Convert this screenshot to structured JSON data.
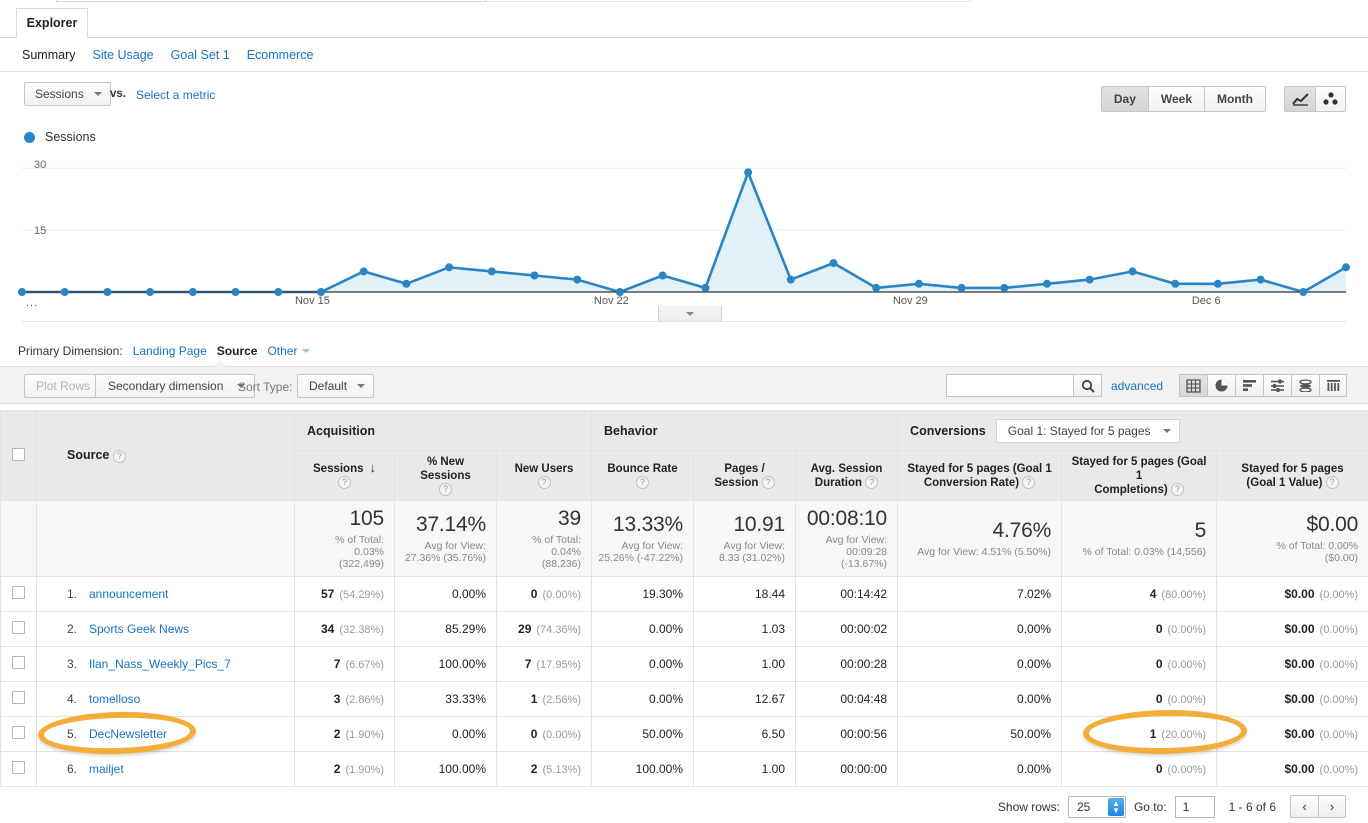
{
  "window": {
    "tab_label": "Explorer"
  },
  "subtabs": [
    {
      "label": "Summary",
      "active": true
    },
    {
      "label": "Site Usage",
      "active": false
    },
    {
      "label": "Goal Set 1",
      "active": false
    },
    {
      "label": "Ecommerce",
      "active": false
    }
  ],
  "metric_bar": {
    "metric_selected": "Sessions",
    "vs_label": "vs.",
    "select_metric_link": "Select a metric",
    "granularity": [
      {
        "label": "Day",
        "active": true
      },
      {
        "label": "Week",
        "active": false
      },
      {
        "label": "Month",
        "active": false
      }
    ],
    "chart_type_icons": [
      {
        "name": "line-chart-icon",
        "active": true
      },
      {
        "name": "motion-chart-icon",
        "active": false
      }
    ]
  },
  "legend": {
    "series_label": "Sessions",
    "color": "#2b85c4"
  },
  "chart_data": {
    "type": "line",
    "title": "Sessions",
    "xlabel": "",
    "ylabel": "Sessions",
    "ylim": [
      0,
      32
    ],
    "yticks": [
      15,
      30
    ],
    "ytick_labels": [
      "15",
      "30"
    ],
    "grid": true,
    "legend_position": "top-left",
    "x_axis_prefix": "...",
    "xtick_labels": [
      "Nov 15",
      "Nov 22",
      "Nov 29",
      "Dec 6"
    ],
    "xtick_indices": [
      7,
      14,
      21,
      28
    ],
    "series": [
      {
        "name": "Sessions",
        "color": "#2b85c4",
        "fill": "#e2f0f8",
        "values": [
          0,
          0,
          0,
          0,
          0,
          0,
          0,
          0,
          5,
          2,
          6,
          5,
          4,
          3,
          0,
          4,
          1,
          29,
          3,
          7,
          1,
          2,
          1,
          1,
          2,
          3,
          5,
          2,
          2,
          3,
          0,
          6
        ]
      }
    ]
  },
  "primary_dimension": {
    "label": "Primary Dimension:",
    "options": [
      {
        "label": "Landing Page",
        "active": false
      },
      {
        "label": "Source",
        "active": true
      },
      {
        "label": "Other",
        "active": false,
        "has_caret": true
      }
    ]
  },
  "toolbar": {
    "plot_rows_label": "Plot Rows",
    "secondary_dimension_label": "Secondary dimension",
    "sort_type_label": "Sort Type:",
    "sort_type_value": "Default",
    "search_value": "",
    "search_placeholder": "",
    "advanced_link": "advanced",
    "view_icons": [
      {
        "name": "table-view-icon",
        "active": true
      },
      {
        "name": "pie-view-icon",
        "active": false
      },
      {
        "name": "bar-view-icon",
        "active": false
      },
      {
        "name": "comparison-view-icon",
        "active": false
      },
      {
        "name": "performance-view-icon",
        "active": false
      },
      {
        "name": "pivot-view-icon",
        "active": false
      }
    ]
  },
  "table": {
    "source_header": "Source",
    "groups": [
      {
        "label": "Acquisition",
        "span": 3
      },
      {
        "label": "Behavior",
        "span": 3
      },
      {
        "label": "Conversions",
        "span": 3,
        "goal_select": "Goal 1: Stayed for 5 pages"
      }
    ],
    "columns": [
      {
        "label": "Sessions",
        "sorted": true,
        "sort_dir": "desc"
      },
      {
        "label": "% New Sessions"
      },
      {
        "label": "New Users"
      },
      {
        "label": "Bounce Rate"
      },
      {
        "label": "Pages /\nSession"
      },
      {
        "label": "Avg. Session\nDuration"
      },
      {
        "label": "Stayed for 5 pages (Goal 1\nConversion Rate)"
      },
      {
        "label": "Stayed for 5 pages (Goal 1\nCompletions)"
      },
      {
        "label": "Stayed for 5 pages\n(Goal 1 Value)"
      }
    ],
    "summary": [
      {
        "big": "105",
        "small": "% of Total:\n0.03%\n(322,499)"
      },
      {
        "big": "37.14%",
        "small": "Avg for View:\n27.36% (35.76%)"
      },
      {
        "big": "39",
        "small": "% of Total:\n0.04%\n(88,236)"
      },
      {
        "big": "13.33%",
        "small": "Avg for View:\n25.26% (-47.22%)"
      },
      {
        "big": "10.91",
        "small": "Avg for View:\n8.33 (31.02%)"
      },
      {
        "big": "00:08:10",
        "small": "Avg for View:\n00:09:28\n(-13.67%)"
      },
      {
        "big": "4.76%",
        "small": "Avg for View: 4.51% (5.50%)"
      },
      {
        "big": "5",
        "small": "% of Total: 0.03% (14,556)"
      },
      {
        "big": "$0.00",
        "small": "% of Total: 0.00%\n($0.00)"
      }
    ],
    "rows": [
      {
        "num": "1.",
        "source": "announcement",
        "sessions": "57",
        "sessions_pct": "(54.29%)",
        "new_sessions_pct": "0.00%",
        "new_users": "0",
        "new_users_pct": "(0.00%)",
        "bounce_rate": "19.30%",
        "pages_session": "18.44",
        "avg_duration": "00:14:42",
        "goal_rate": "7.02%",
        "goal_completions": "4",
        "goal_completions_pct": "(80.00%)",
        "goal_value": "$0.00",
        "goal_value_pct": "(0.00%)"
      },
      {
        "num": "2.",
        "source": "Sports Geek News",
        "sessions": "34",
        "sessions_pct": "(32.38%)",
        "new_sessions_pct": "85.29%",
        "new_users": "29",
        "new_users_pct": "(74.36%)",
        "bounce_rate": "0.00%",
        "pages_session": "1.03",
        "avg_duration": "00:00:02",
        "goal_rate": "0.00%",
        "goal_completions": "0",
        "goal_completions_pct": "(0.00%)",
        "goal_value": "$0.00",
        "goal_value_pct": "(0.00%)"
      },
      {
        "num": "3.",
        "source": "Ilan_Nass_Weekly_Pics_7",
        "sessions": "7",
        "sessions_pct": "(6.67%)",
        "new_sessions_pct": "100.00%",
        "new_users": "7",
        "new_users_pct": "(17.95%)",
        "bounce_rate": "0.00%",
        "pages_session": "1.00",
        "avg_duration": "00:00:28",
        "goal_rate": "0.00%",
        "goal_completions": "0",
        "goal_completions_pct": "(0.00%)",
        "goal_value": "$0.00",
        "goal_value_pct": "(0.00%)"
      },
      {
        "num": "4.",
        "source": "tomelloso",
        "sessions": "3",
        "sessions_pct": "(2.86%)",
        "new_sessions_pct": "33.33%",
        "new_users": "1",
        "new_users_pct": "(2.56%)",
        "bounce_rate": "0.00%",
        "pages_session": "12.67",
        "avg_duration": "00:04:48",
        "goal_rate": "0.00%",
        "goal_completions": "0",
        "goal_completions_pct": "(0.00%)",
        "goal_value": "$0.00",
        "goal_value_pct": "(0.00%)"
      },
      {
        "num": "5.",
        "source": "DecNewsletter",
        "sessions": "2",
        "sessions_pct": "(1.90%)",
        "new_sessions_pct": "0.00%",
        "new_users": "0",
        "new_users_pct": "(0.00%)",
        "bounce_rate": "50.00%",
        "pages_session": "6.50",
        "avg_duration": "00:00:56",
        "goal_rate": "50.00%",
        "goal_completions": "1",
        "goal_completions_pct": "(20.00%)",
        "goal_value": "$0.00",
        "goal_value_pct": "(0.00%)"
      },
      {
        "num": "6.",
        "source": "mailjet",
        "sessions": "2",
        "sessions_pct": "(1.90%)",
        "new_sessions_pct": "100.00%",
        "new_users": "2",
        "new_users_pct": "(5.13%)",
        "bounce_rate": "100.00%",
        "pages_session": "1.00",
        "avg_duration": "00:00:00",
        "goal_rate": "0.00%",
        "goal_completions": "0",
        "goal_completions_pct": "(0.00%)",
        "goal_value": "$0.00",
        "goal_value_pct": "(0.00%)"
      }
    ]
  },
  "highlights": {
    "color": "#f4a72a",
    "items": [
      {
        "name": "highlight-source-decnewsletter",
        "target": "row 5 Source"
      },
      {
        "name": "highlight-goal-completions",
        "target": "row 5 Goal 1 Completions"
      }
    ]
  },
  "footer": {
    "show_rows_label": "Show rows:",
    "show_rows_value": "25",
    "goto_label": "Go to:",
    "goto_value": "1",
    "range_label": "1 - 6 of 6",
    "prev_icon": "‹",
    "next_icon": "›"
  }
}
